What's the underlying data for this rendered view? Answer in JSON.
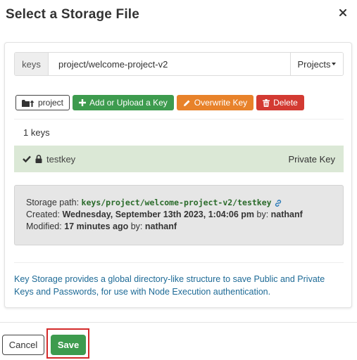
{
  "dialog": {
    "title": "Select a Storage File",
    "close_icon": "close-icon"
  },
  "path_bar": {
    "addon_label": "keys",
    "value": "project/welcome-project-v2",
    "dropdown_label": "Projects"
  },
  "toolbar": {
    "up_label": "project",
    "add_label": "Add or Upload a Key",
    "overwrite_label": "Overwrite Key",
    "delete_label": "Delete"
  },
  "keys": {
    "count_label": "1 keys",
    "items": [
      {
        "name": "testkey",
        "type": "Private Key"
      }
    ]
  },
  "details": {
    "storage_path_label": "Storage path:",
    "storage_path_value": "keys/project/welcome-project-v2/testkey",
    "created_label": "Created:",
    "created_value": "Wednesday, September 13th 2023, 1:04:06 pm",
    "created_by_label": "by:",
    "created_by_value": "nathanf",
    "modified_label": "Modified:",
    "modified_value": "17 minutes ago",
    "modified_by_label": "by:",
    "modified_by_value": "nathanf"
  },
  "help_text": "Key Storage provides a global directory-like structure to save Public and Private Keys and Passwords, for use with Node Execution authentication.",
  "footer": {
    "cancel_label": "Cancel",
    "save_label": "Save"
  },
  "colors": {
    "success": "#3d9b4e",
    "warning": "#e8822a",
    "danger": "#d33a32",
    "selected_row": "#dbe8d6",
    "help_text": "#1d6a96",
    "highlight": "#d42a2a"
  }
}
